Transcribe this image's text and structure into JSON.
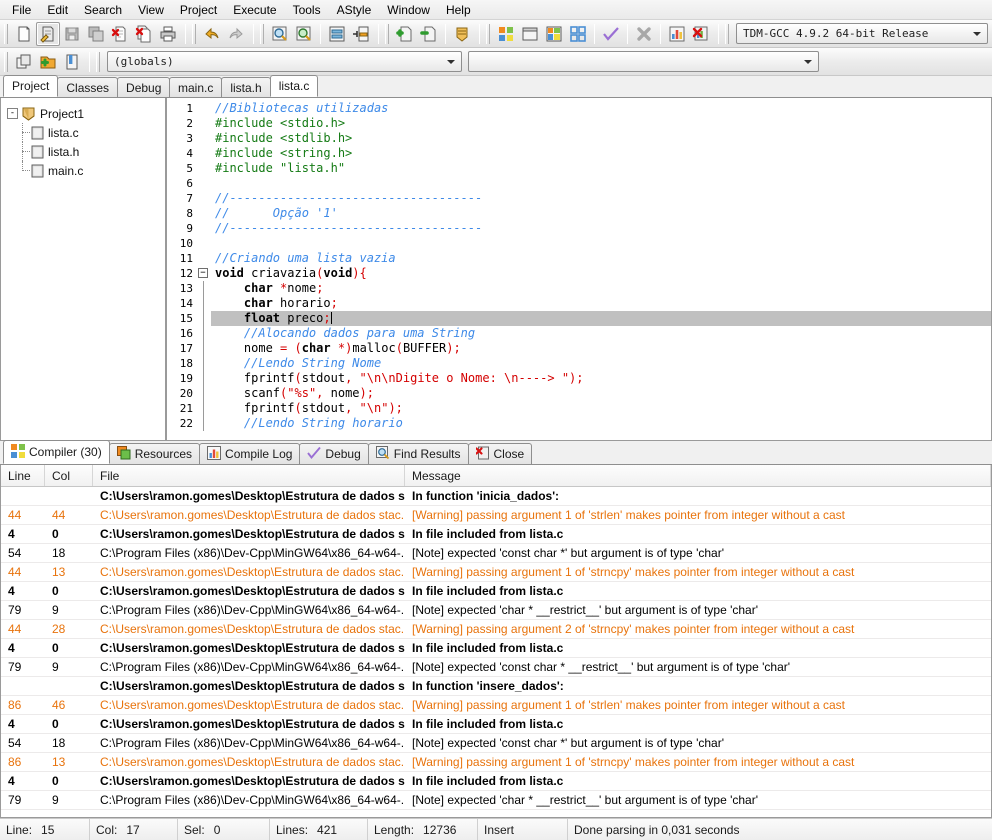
{
  "menu": {
    "items": [
      "File",
      "Edit",
      "Search",
      "View",
      "Project",
      "Execute",
      "Tools",
      "AStyle",
      "Window",
      "Help"
    ]
  },
  "toolbar": {
    "groups": [
      {
        "name": "file-group",
        "buttons": [
          {
            "icon": "new-file-icon",
            "label": "New"
          },
          {
            "icon": "open-file-icon",
            "label": "Open",
            "pressed": true
          },
          {
            "icon": "save-icon",
            "label": "Save"
          },
          {
            "icon": "save-all-icon",
            "label": "Save All"
          },
          {
            "icon": "close-file-icon",
            "label": "Close"
          },
          {
            "icon": "close-all-icon",
            "label": "Close All"
          },
          {
            "icon": "print-icon",
            "label": "Print"
          }
        ]
      },
      {
        "name": "undo-group",
        "buttons": [
          {
            "icon": "undo-icon",
            "label": "Undo"
          },
          {
            "icon": "redo-icon",
            "label": "Redo"
          }
        ]
      },
      {
        "name": "search-group",
        "buttons": [
          {
            "icon": "find-icon",
            "label": "Find"
          },
          {
            "icon": "replace-icon",
            "label": "Replace"
          },
          {
            "icon": "goto-line-icon",
            "label": "Goto Line"
          },
          {
            "icon": "goto-func-icon",
            "label": "Goto Function"
          }
        ]
      },
      {
        "name": "project-group",
        "buttons": [
          {
            "icon": "add-to-project-icon",
            "label": "Add To Project"
          },
          {
            "icon": "remove-from-project-icon",
            "label": "Remove From Project"
          },
          {
            "icon": "project-options-icon",
            "label": "Project Options"
          }
        ]
      },
      {
        "name": "compile-group",
        "buttons": [
          {
            "icon": "compile-icon",
            "label": "Compile"
          },
          {
            "icon": "run-icon",
            "label": "Run"
          },
          {
            "icon": "compile-and-run-icon",
            "label": "Compile & Run"
          },
          {
            "icon": "rebuild-all-icon",
            "label": "Rebuild All"
          },
          {
            "icon": "syntax-check-icon",
            "label": "Syntax Check"
          },
          {
            "icon": "stop-icon",
            "label": "Stop Execution"
          },
          {
            "icon": "profile-icon",
            "label": "Profile Analysis"
          },
          {
            "icon": "delete-profile-icon",
            "label": "Delete Profiling Information"
          }
        ]
      }
    ],
    "compiler_set": "TDM-GCC 4.9.2 64-bit Release",
    "row2_buttons": [
      {
        "icon": "insert-icon",
        "label": "Insert"
      },
      {
        "icon": "new-class-icon",
        "label": "New Class"
      },
      {
        "icon": "toggle-bookmark-icon",
        "label": "Toggle Bookmark"
      }
    ],
    "globals_value": "(globals)",
    "class_value": ""
  },
  "left_panel": {
    "tabs": [
      {
        "label": "Project",
        "active": true
      },
      {
        "label": "Classes",
        "active": false
      },
      {
        "label": "Debug",
        "active": false
      }
    ],
    "tree": {
      "root": {
        "label": "Project1",
        "icon": "project-icon",
        "expander": "-"
      },
      "children": [
        {
          "label": "lista.c",
          "icon": "source-file-icon"
        },
        {
          "label": "lista.h",
          "icon": "header-file-icon"
        },
        {
          "label": "main.c",
          "icon": "source-file-icon"
        }
      ]
    }
  },
  "editor": {
    "tabs": [
      {
        "label": "main.c",
        "active": false
      },
      {
        "label": "lista.h",
        "active": false
      },
      {
        "label": "lista.c",
        "active": true
      }
    ],
    "first_line": 1,
    "highlight_line": 15,
    "fold_line": 12,
    "lines": [
      {
        "n": 1,
        "tokens": [
          {
            "t": "//Bibliotecas utilizadas",
            "c": "cmt"
          }
        ]
      },
      {
        "n": 2,
        "tokens": [
          {
            "t": "#include <stdio.h>",
            "c": "pre"
          }
        ]
      },
      {
        "n": 3,
        "tokens": [
          {
            "t": "#include <stdlib.h>",
            "c": "pre"
          }
        ]
      },
      {
        "n": 4,
        "tokens": [
          {
            "t": "#include <string.h>",
            "c": "pre"
          }
        ]
      },
      {
        "n": 5,
        "tokens": [
          {
            "t": "#include \"lista.h\"",
            "c": "pre"
          }
        ]
      },
      {
        "n": 6,
        "tokens": []
      },
      {
        "n": 7,
        "tokens": [
          {
            "t": "//-----------------------------------",
            "c": "cmt"
          }
        ]
      },
      {
        "n": 8,
        "tokens": [
          {
            "t": "//      Opção '1'",
            "c": "cmt"
          }
        ]
      },
      {
        "n": 9,
        "tokens": [
          {
            "t": "//-----------------------------------",
            "c": "cmt"
          }
        ]
      },
      {
        "n": 10,
        "tokens": []
      },
      {
        "n": 11,
        "tokens": [
          {
            "t": "//Criando uma lista vazia",
            "c": "cmt"
          }
        ]
      },
      {
        "n": 12,
        "tokens": [
          {
            "t": "void",
            "c": "kw"
          },
          {
            "t": " criavazia",
            "c": "id"
          },
          {
            "t": "(",
            "c": "pun"
          },
          {
            "t": "void",
            "c": "kw"
          },
          {
            "t": "){",
            "c": "pun"
          }
        ]
      },
      {
        "n": 13,
        "tokens": [
          {
            "t": "    ",
            "c": "id"
          },
          {
            "t": "char",
            "c": "kw"
          },
          {
            "t": " ",
            "c": "id"
          },
          {
            "t": "*",
            "c": "pun"
          },
          {
            "t": "nome",
            "c": "id"
          },
          {
            "t": ";",
            "c": "pun"
          }
        ]
      },
      {
        "n": 14,
        "tokens": [
          {
            "t": "    ",
            "c": "id"
          },
          {
            "t": "char",
            "c": "kw"
          },
          {
            "t": " horario",
            "c": "id"
          },
          {
            "t": ";",
            "c": "pun"
          }
        ]
      },
      {
        "n": 15,
        "tokens": [
          {
            "t": "    ",
            "c": "id"
          },
          {
            "t": "float",
            "c": "kw"
          },
          {
            "t": " preco",
            "c": "id"
          },
          {
            "t": ";",
            "c": "pun"
          }
        ]
      },
      {
        "n": 16,
        "tokens": [
          {
            "t": "    //Alocando dados para uma String",
            "c": "cmt"
          }
        ]
      },
      {
        "n": 17,
        "tokens": [
          {
            "t": "    nome ",
            "c": "id"
          },
          {
            "t": "=",
            "c": "pun"
          },
          {
            "t": " ",
            "c": "id"
          },
          {
            "t": "(",
            "c": "pun"
          },
          {
            "t": "char",
            "c": "kw"
          },
          {
            "t": " ",
            "c": "id"
          },
          {
            "t": "*",
            "c": "pun"
          },
          {
            "t": ")",
            "c": "pun"
          },
          {
            "t": "malloc",
            "c": "id"
          },
          {
            "t": "(",
            "c": "pun"
          },
          {
            "t": "BUFFER",
            "c": "id"
          },
          {
            "t": ");",
            "c": "pun"
          }
        ]
      },
      {
        "n": 18,
        "tokens": [
          {
            "t": "    //Lendo String Nome",
            "c": "cmt"
          }
        ]
      },
      {
        "n": 19,
        "tokens": [
          {
            "t": "    fprintf",
            "c": "id"
          },
          {
            "t": "(",
            "c": "pun"
          },
          {
            "t": "stdout",
            "c": "id"
          },
          {
            "t": ", ",
            "c": "pun"
          },
          {
            "t": "\"\\n\\nDigite o Nome: \\n----> \"",
            "c": "str"
          },
          {
            "t": ");",
            "c": "pun"
          }
        ]
      },
      {
        "n": 20,
        "tokens": [
          {
            "t": "    scanf",
            "c": "id"
          },
          {
            "t": "(",
            "c": "pun"
          },
          {
            "t": "\"%s\"",
            "c": "str"
          },
          {
            "t": ", ",
            "c": "pun"
          },
          {
            "t": "nome",
            "c": "id"
          },
          {
            "t": ");",
            "c": "pun"
          }
        ]
      },
      {
        "n": 21,
        "tokens": [
          {
            "t": "    fprintf",
            "c": "id"
          },
          {
            "t": "(",
            "c": "pun"
          },
          {
            "t": "stdout",
            "c": "id"
          },
          {
            "t": ", ",
            "c": "pun"
          },
          {
            "t": "\"\\n\"",
            "c": "str"
          },
          {
            "t": ");",
            "c": "pun"
          }
        ]
      },
      {
        "n": 22,
        "tokens": [
          {
            "t": "    //Lendo String horario",
            "c": "cmt"
          }
        ]
      }
    ]
  },
  "bottom_panel": {
    "tabs": [
      {
        "label": "Compiler (30)",
        "icon": "compiler-icon",
        "active": true
      },
      {
        "label": "Resources",
        "icon": "resources-icon",
        "active": false
      },
      {
        "label": "Compile Log",
        "icon": "compile-log-icon",
        "active": false
      },
      {
        "label": "Debug",
        "icon": "debug-icon",
        "active": false
      },
      {
        "label": "Find Results",
        "icon": "find-results-icon",
        "active": false
      },
      {
        "label": "Close",
        "icon": "close-icon",
        "active": false
      }
    ],
    "columns": [
      "Line",
      "Col",
      "File",
      "Message"
    ],
    "rows": [
      {
        "line": "",
        "col": "",
        "file": "C:\\Users\\ramon.gomes\\Desktop\\Estrutura de dados s...",
        "message": "In function 'inicia_dados':",
        "sev": "info"
      },
      {
        "line": "44",
        "col": "44",
        "file": "C:\\Users\\ramon.gomes\\Desktop\\Estrutura de dados stac...",
        "message": "[Warning] passing argument 1 of 'strlen' makes pointer from integer without a cast",
        "sev": "warning"
      },
      {
        "line": "4",
        "col": "0",
        "file": "C:\\Users\\ramon.gomes\\Desktop\\Estrutura de dados s...",
        "message": "In file included from lista.c",
        "sev": "info"
      },
      {
        "line": "54",
        "col": "18",
        "file": "C:\\Program Files (x86)\\Dev-Cpp\\MinGW64\\x86_64-w64-...",
        "message": "[Note] expected 'const char *' but argument is of type 'char'",
        "sev": "note"
      },
      {
        "line": "44",
        "col": "13",
        "file": "C:\\Users\\ramon.gomes\\Desktop\\Estrutura de dados stac...",
        "message": "[Warning] passing argument 1 of 'strncpy' makes pointer from integer without a cast",
        "sev": "warning"
      },
      {
        "line": "4",
        "col": "0",
        "file": "C:\\Users\\ramon.gomes\\Desktop\\Estrutura de dados s...",
        "message": "In file included from lista.c",
        "sev": "info"
      },
      {
        "line": "79",
        "col": "9",
        "file": "C:\\Program Files (x86)\\Dev-Cpp\\MinGW64\\x86_64-w64-...",
        "message": "[Note] expected 'char * __restrict__' but argument is of type 'char'",
        "sev": "note"
      },
      {
        "line": "44",
        "col": "28",
        "file": "C:\\Users\\ramon.gomes\\Desktop\\Estrutura de dados stac...",
        "message": "[Warning] passing argument 2 of 'strncpy' makes pointer from integer without a cast",
        "sev": "warning"
      },
      {
        "line": "4",
        "col": "0",
        "file": "C:\\Users\\ramon.gomes\\Desktop\\Estrutura de dados s...",
        "message": "In file included from lista.c",
        "sev": "info"
      },
      {
        "line": "79",
        "col": "9",
        "file": "C:\\Program Files (x86)\\Dev-Cpp\\MinGW64\\x86_64-w64-...",
        "message": "[Note] expected 'const char * __restrict__' but argument is of type 'char'",
        "sev": "note"
      },
      {
        "line": "",
        "col": "",
        "file": "C:\\Users\\ramon.gomes\\Desktop\\Estrutura de dados s...",
        "message": "In function 'insere_dados':",
        "sev": "info"
      },
      {
        "line": "86",
        "col": "46",
        "file": "C:\\Users\\ramon.gomes\\Desktop\\Estrutura de dados stac...",
        "message": "[Warning] passing argument 1 of 'strlen' makes pointer from integer without a cast",
        "sev": "warning"
      },
      {
        "line": "4",
        "col": "0",
        "file": "C:\\Users\\ramon.gomes\\Desktop\\Estrutura de dados s...",
        "message": "In file included from lista.c",
        "sev": "info"
      },
      {
        "line": "54",
        "col": "18",
        "file": "C:\\Program Files (x86)\\Dev-Cpp\\MinGW64\\x86_64-w64-...",
        "message": "[Note] expected 'const char *' but argument is of type 'char'",
        "sev": "note"
      },
      {
        "line": "86",
        "col": "13",
        "file": "C:\\Users\\ramon.gomes\\Desktop\\Estrutura de dados stac...",
        "message": "[Warning] passing argument 1 of 'strncpy' makes pointer from integer without a cast",
        "sev": "warning"
      },
      {
        "line": "4",
        "col": "0",
        "file": "C:\\Users\\ramon.gomes\\Desktop\\Estrutura de dados s...",
        "message": "In file included from lista.c",
        "sev": "info"
      },
      {
        "line": "79",
        "col": "9",
        "file": "C:\\Program Files (x86)\\Dev-Cpp\\MinGW64\\x86_64-w64-...",
        "message": "[Note] expected 'char * __restrict__' but argument is of type 'char'",
        "sev": "note"
      }
    ]
  },
  "statusbar": {
    "line_label": "Line:",
    "line_value": "15",
    "col_label": "Col:",
    "col_value": "17",
    "sel_label": "Sel:",
    "sel_value": "0",
    "lines_label": "Lines:",
    "lines_value": "421",
    "length_label": "Length:",
    "length_value": "12736",
    "mode": "Insert",
    "message": "Done parsing in 0,031 seconds"
  },
  "colors": {
    "warning": "#e8730c",
    "comment": "#3e8ae8",
    "preprocessor": "#157b15",
    "string": "#d40000",
    "highlight": "#c0c0c0"
  }
}
